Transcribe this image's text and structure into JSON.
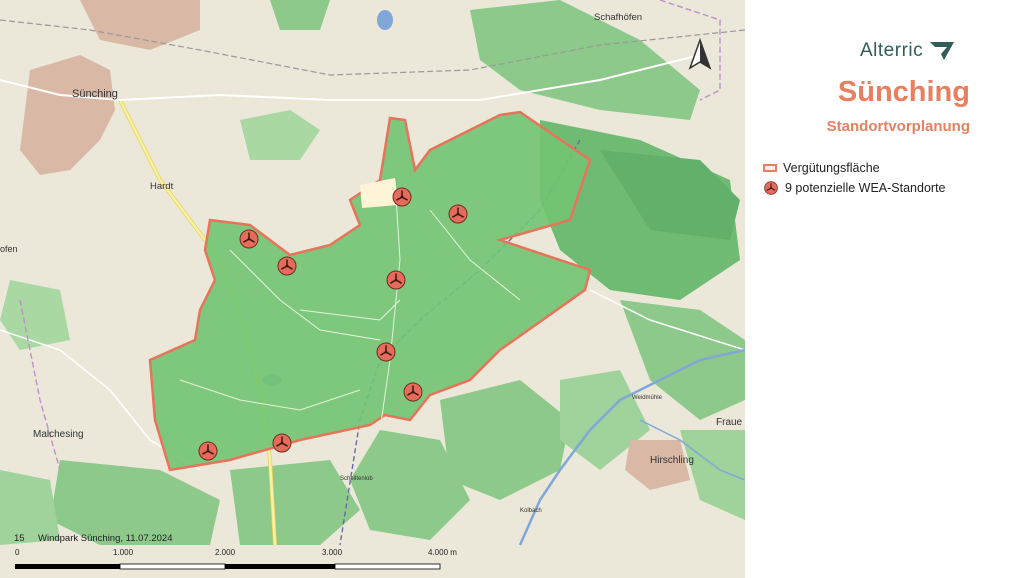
{
  "map": {
    "towns": [
      {
        "name": "Sünching",
        "key": "suenching"
      },
      {
        "name": "Schafhöfen",
        "key": "schafhoefen"
      },
      {
        "name": "Hardt",
        "key": "hardt"
      },
      {
        "name": "Malchesing",
        "key": "malchesing"
      },
      {
        "name": "Hirschling",
        "key": "hirschling"
      },
      {
        "name": "Scheiltenlob",
        "key": "scheiltenlob"
      },
      {
        "name": "Weidmühle",
        "key": "weidmuehle"
      },
      {
        "name": "Kolbach",
        "key": "kolbach"
      },
      {
        "name": "Fraue",
        "key": "fraue"
      },
      {
        "name": "ofen",
        "key": "ofen"
      }
    ],
    "north_arrow": "north-arrow-icon",
    "turbine_count": 9,
    "colors": {
      "base": "#ebe8d9",
      "forest": "#8cc98a",
      "forest_dark": "#62b06a",
      "area_fill": "#72c472",
      "area_border": "#e8735a",
      "turbine": "#e66b5a",
      "road": "#f7f1a5",
      "water": "#7fa8d8"
    }
  },
  "panel": {
    "brand": "Alterric",
    "title": "Sünching",
    "subtitle": "Standortvorplanung",
    "legend": {
      "area": "Vergütungsfläche",
      "turbines": "9 potenzielle WEA-Standorte"
    }
  },
  "scalebar": {
    "number": "15",
    "caption": "Windpark Sünching, 11.07.2024",
    "ticks": [
      "0",
      "1.000",
      "2.000",
      "3.000",
      "4.000 m"
    ]
  }
}
